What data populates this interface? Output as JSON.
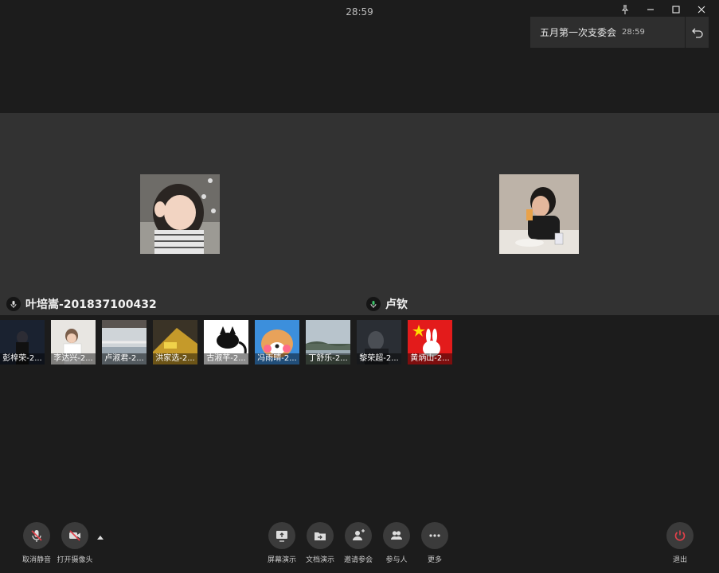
{
  "header": {
    "timer": "28:59",
    "meeting_title": "五月第一次支委会",
    "meeting_time": "28:59"
  },
  "window_controls": [
    "pin-icon",
    "minimize-icon",
    "maximize-icon",
    "close-icon"
  ],
  "stage": {
    "left": {
      "name": "叶培嵩-201837100432",
      "mic": "mic-icon"
    },
    "right": {
      "name": "卢钦",
      "mic": "mic-active-icon"
    }
  },
  "participants": [
    {
      "label": "彭梓荣-2..."
    },
    {
      "label": "李达兴-2..."
    },
    {
      "label": "卢淑君-2..."
    },
    {
      "label": "洪家选-2..."
    },
    {
      "label": "古淑芊-2..."
    },
    {
      "label": "冯雨晴-2..."
    },
    {
      "label": "丁舒乐-2..."
    },
    {
      "label": "黎荣超-2..."
    },
    {
      "label": "黄炳山-2..."
    }
  ],
  "controls": {
    "unmute": "取消静音",
    "camera": "打开摄像头",
    "share_screen": "屏幕演示",
    "share_doc": "文档演示",
    "invite": "邀请参会",
    "participants": "参与人",
    "more": "更多",
    "exit": "退出"
  },
  "colors": {
    "background": "#1c1c1c",
    "stage": "#323232",
    "exit_red": "#e5404a",
    "mic_green": "#3cc46a"
  }
}
